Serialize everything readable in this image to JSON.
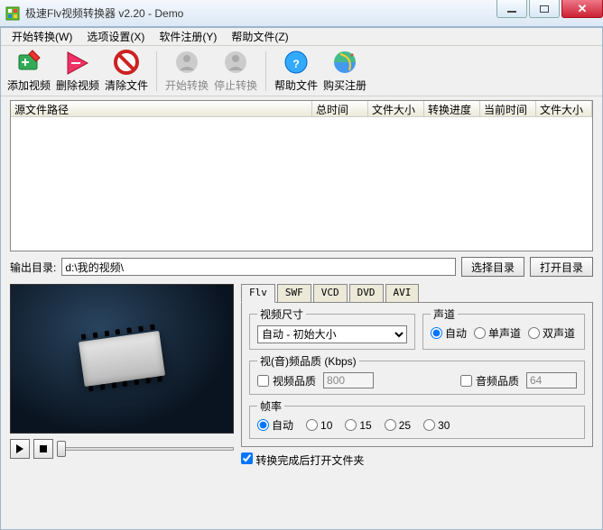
{
  "window": {
    "title": "极速Flv视频转换器 v2.20 - Demo"
  },
  "menu": {
    "start": "开始转换(W)",
    "options": "选项设置(X)",
    "register": "软件注册(Y)",
    "help": "帮助文件(Z)"
  },
  "toolbar": {
    "add": "添加视频",
    "remove": "删除视频",
    "clear": "清除文件",
    "start": "开始转换",
    "stop": "停止转换",
    "help": "帮助文件",
    "buy": "购买注册"
  },
  "columns": {
    "path": "源文件路径",
    "total_time": "总时间",
    "file_size": "文件大小",
    "progress": "转换进度",
    "cur_time": "当前时间",
    "file_size2": "文件大小"
  },
  "output": {
    "label": "输出目录:",
    "value": "d:\\我的视频\\",
    "browse": "选择目录",
    "open": "打开目录"
  },
  "tabs": {
    "flv": "Flv",
    "swf": "SWF",
    "vcd": "VCD",
    "dvd": "DVD",
    "avi": "AVI"
  },
  "settings": {
    "video_size_legend": "视频尺寸",
    "video_size_value": "自动 - 初始大小",
    "audio_legend": "声道",
    "audio_auto": "自动",
    "audio_mono": "单声道",
    "audio_stereo": "双声道",
    "quality_legend": "视(音)频品质 (Kbps)",
    "video_quality_label": "视频品质",
    "video_quality_value": "800",
    "audio_quality_label": "音频品质",
    "audio_quality_value": "64",
    "fps_legend": "帧率",
    "fps_auto": "自动",
    "fps_10": "10",
    "fps_15": "15",
    "fps_25": "25",
    "fps_30": "30",
    "open_after_label": "转换完成后打开文件夹"
  }
}
